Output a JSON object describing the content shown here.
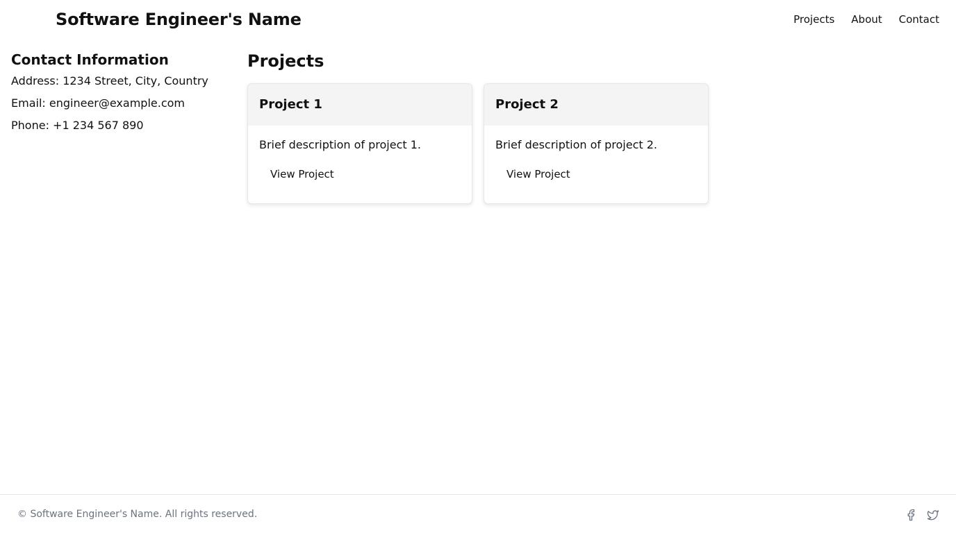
{
  "header": {
    "title": "Software Engineer's Name",
    "nav": [
      {
        "label": "Projects"
      },
      {
        "label": "About"
      },
      {
        "label": "Contact"
      }
    ]
  },
  "sidebar": {
    "heading": "Contact Information",
    "address": "Address: 1234 Street, City, Country",
    "email": "Email: engineer@example.com",
    "phone": "Phone: +1 234 567 890"
  },
  "main": {
    "heading": "Projects",
    "projects": [
      {
        "title": "Project 1",
        "description": "Brief description of project 1.",
        "button_label": "View Project"
      },
      {
        "title": "Project 2",
        "description": "Brief description of project 2.",
        "button_label": "View Project"
      }
    ]
  },
  "footer": {
    "copyright": "© Software Engineer's Name. All rights reserved.",
    "social_icons": [
      "facebook-icon",
      "twitter-icon"
    ]
  },
  "colors": {
    "text": "#111111",
    "muted": "#6b7280",
    "card_header_bg": "#f4f4f4",
    "border": "#e5e5e5"
  }
}
